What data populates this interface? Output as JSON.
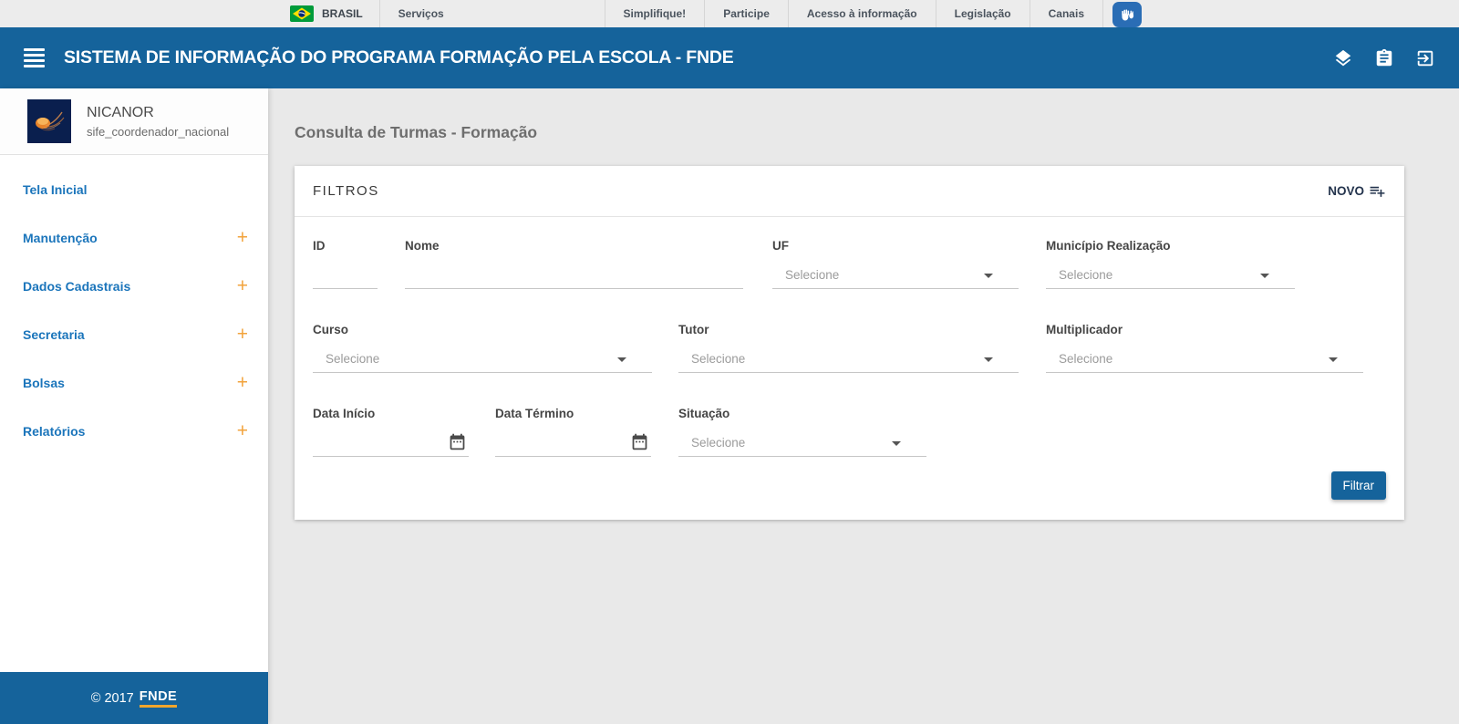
{
  "colors": {
    "header_blue": "#15639b",
    "link_blue": "#1b75bb",
    "accent_orange": "#f2a33c",
    "vlibras_blue": "#2a6db5"
  },
  "govbar": {
    "brand": "BRASIL",
    "services": "Serviços",
    "links": [
      "Simplifique!",
      "Participe",
      "Acesso à informação",
      "Legislação",
      "Canais"
    ]
  },
  "header": {
    "title": "SISTEMA DE INFORMAÇÃO DO PROGRAMA FORMAÇÃO PELA ESCOLA - FNDE"
  },
  "sidebar": {
    "user": {
      "name": "NICANOR",
      "role": "sife_coordenador_nacional"
    },
    "items": [
      {
        "label": "Tela Inicial",
        "suffix": ""
      },
      {
        "label": "Manutenção",
        "suffix": "+"
      },
      {
        "label": "Dados Cadastrais",
        "suffix": "+"
      },
      {
        "label": "Secretaria",
        "suffix": "+"
      },
      {
        "label": "Bolsas",
        "suffix": "+"
      },
      {
        "label": "Relatórios",
        "suffix": "+"
      }
    ],
    "footer": {
      "text": "© 2017",
      "brand": "FNDE"
    }
  },
  "main": {
    "page_title": "Consulta de Turmas - Formação",
    "panel": {
      "title": "FILTROS",
      "new_label": "NOVO",
      "filter_label": "Filtrar",
      "fields": {
        "id": {
          "label": "ID",
          "value": "",
          "placeholder": ""
        },
        "nome": {
          "label": "Nome",
          "value": "",
          "placeholder": ""
        },
        "uf": {
          "label": "UF",
          "placeholder": "Selecione"
        },
        "municipio": {
          "label": "Município Realização",
          "placeholder": "Selecione"
        },
        "curso": {
          "label": "Curso",
          "placeholder": "Selecione"
        },
        "tutor": {
          "label": "Tutor",
          "placeholder": "Selecione"
        },
        "multiplicador": {
          "label": "Multiplicador",
          "placeholder": "Selecione"
        },
        "data_inicio": {
          "label": "Data Início",
          "value": ""
        },
        "data_termino": {
          "label": "Data Término",
          "value": ""
        },
        "situacao": {
          "label": "Situação",
          "placeholder": "Selecione"
        }
      }
    }
  }
}
